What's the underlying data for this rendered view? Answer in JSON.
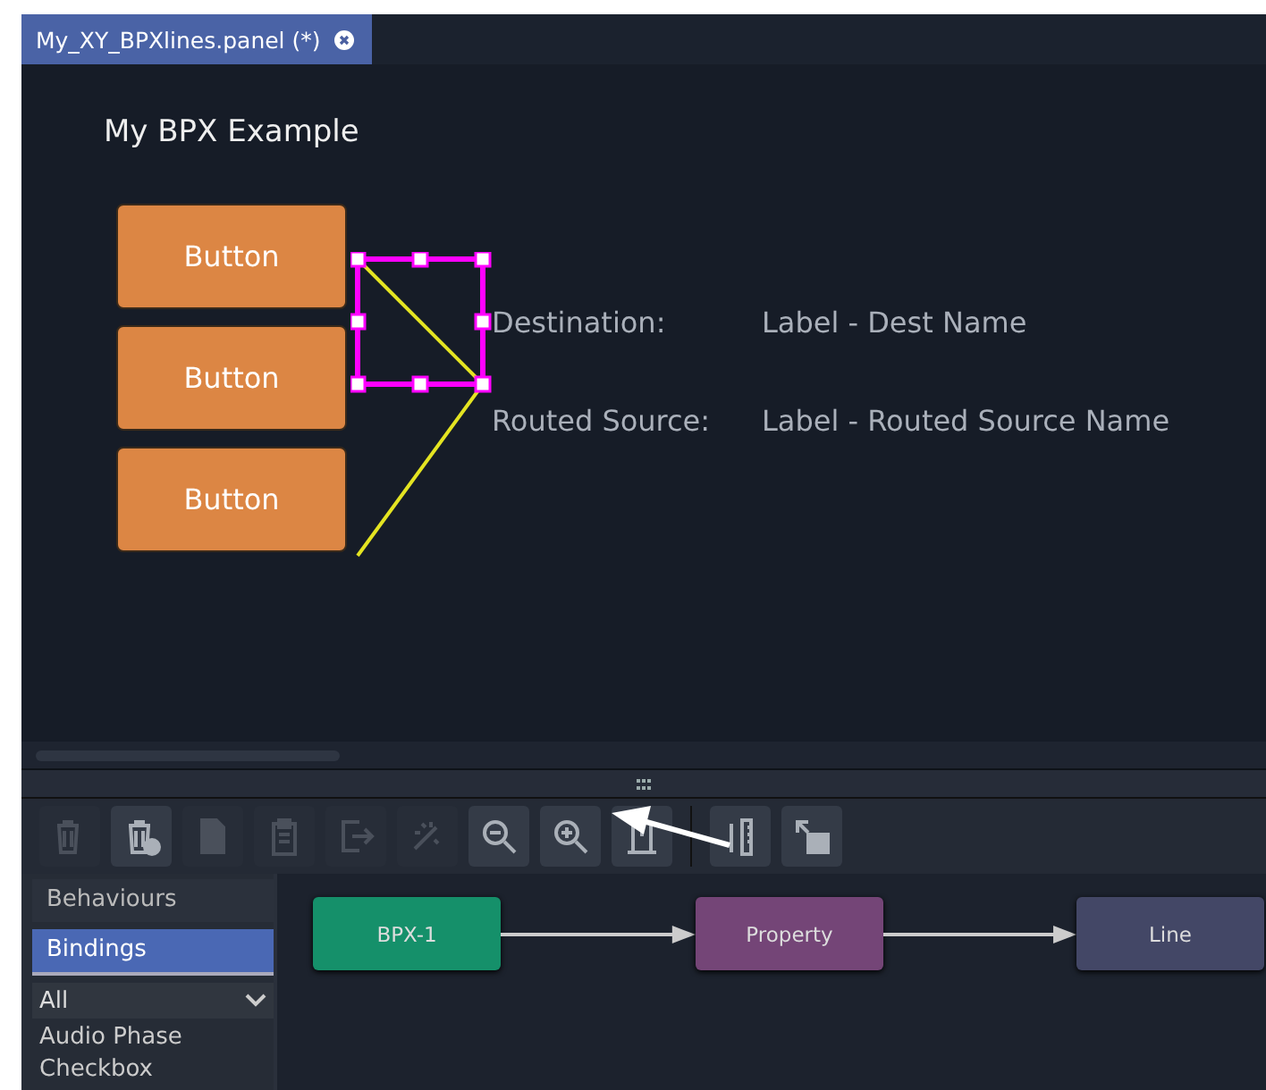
{
  "tabs": [
    {
      "label": "My_XY_BPXlines.panel (*)",
      "selected": true
    }
  ],
  "canvas": {
    "title": "My BPX Example",
    "buttons": [
      "Button",
      "Button",
      "Button"
    ],
    "fields": [
      {
        "label": "Destination:",
        "value": "Label - Dest Name"
      },
      {
        "label": "Routed Source:",
        "value": "Label - Routed Source Name"
      }
    ]
  },
  "toolbar": [
    {
      "kind": "trash",
      "disabled": true
    },
    {
      "kind": "trash-clear",
      "disabled": false
    },
    {
      "kind": "page",
      "disabled": true
    },
    {
      "kind": "clipboard",
      "disabled": true
    },
    {
      "kind": "export",
      "disabled": true
    },
    {
      "kind": "wand",
      "disabled": true
    },
    {
      "kind": "zoom-out",
      "disabled": false
    },
    {
      "kind": "zoom-in",
      "disabled": false
    },
    {
      "kind": "fit",
      "disabled": false
    },
    {
      "kind": "ruler",
      "disabled": false
    },
    {
      "kind": "window",
      "disabled": false
    }
  ],
  "sidebar": {
    "tabs": [
      {
        "label": "Behaviours",
        "selected": false
      },
      {
        "label": "Bindings",
        "selected": true
      }
    ],
    "filter": {
      "value": "All"
    },
    "items": [
      "Audio Phase",
      "Checkbox"
    ]
  },
  "graph": {
    "nodes": [
      {
        "label": "BPX-1",
        "color": "#15906a"
      },
      {
        "label": "Property",
        "color": "#744577"
      },
      {
        "label": "Line",
        "color": "#434766"
      }
    ]
  }
}
